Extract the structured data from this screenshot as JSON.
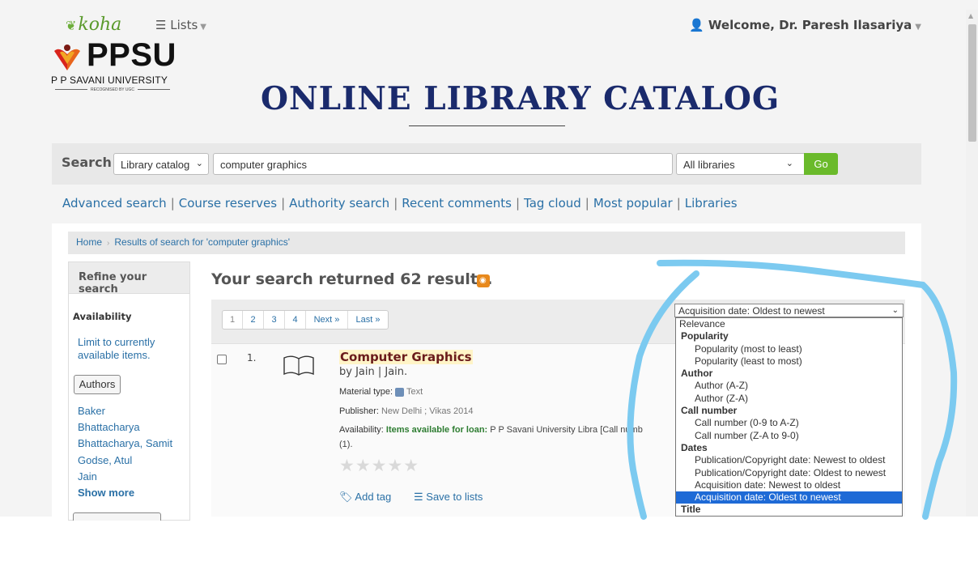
{
  "topbar": {
    "koha_label": "koha",
    "lists_label": "Lists",
    "welcome_text": "Welcome, Dr. Paresh Ilasariya"
  },
  "branding": {
    "logo_text": "PPSU",
    "university_name": "P P SAVANI UNIVERSITY",
    "recognition": "RECOGNISED BY UGC",
    "catalog_title": "ONLINE LIBRARY CATALOG"
  },
  "search": {
    "label": "Search",
    "scope_value": "Library catalog",
    "query_value": "computer graphics",
    "branch_value": "All libraries",
    "go_label": "Go"
  },
  "links": [
    "Advanced search",
    "Course reserves",
    "Authority search",
    "Recent comments",
    "Tag cloud",
    "Most popular",
    "Libraries"
  ],
  "breadcrumb": {
    "home": "Home",
    "current": "Results of search for 'computer graphics'"
  },
  "refine": {
    "heading": "Refine your search",
    "availability_title": "Availability",
    "limit_link": "Limit to currently available items.",
    "authors_button": "Authors",
    "authors": [
      "Baker",
      "Bhattacharya",
      "Bhattacharya, Samit",
      "Godse, Atul",
      "Jain"
    ],
    "show_more": "Show more"
  },
  "results": {
    "summary": "Your search returned 62 results.",
    "pager": [
      "1",
      "2",
      "3",
      "4",
      "Next »",
      "Last »"
    ],
    "sort_selected": "Acquisition date: Oldest to newest",
    "sort_options": [
      {
        "label": "Relevance",
        "kind": "plain"
      },
      {
        "label": "Popularity",
        "kind": "group"
      },
      {
        "label": "Popularity (most to least)",
        "kind": "option"
      },
      {
        "label": "Popularity (least to most)",
        "kind": "option"
      },
      {
        "label": "Author",
        "kind": "group"
      },
      {
        "label": "Author (A-Z)",
        "kind": "option"
      },
      {
        "label": "Author (Z-A)",
        "kind": "option"
      },
      {
        "label": "Call number",
        "kind": "group"
      },
      {
        "label": "Call number (0-9 to A-Z)",
        "kind": "option"
      },
      {
        "label": "Call number (Z-A to 9-0)",
        "kind": "option"
      },
      {
        "label": "Dates",
        "kind": "group"
      },
      {
        "label": "Publication/Copyright date: Newest to oldest",
        "kind": "option"
      },
      {
        "label": "Publication/Copyright date: Oldest to newest",
        "kind": "option"
      },
      {
        "label": "Acquisition date: Newest to oldest",
        "kind": "option"
      },
      {
        "label": "Acquisition date: Oldest to newest",
        "kind": "option",
        "selected": true
      },
      {
        "label": "Title",
        "kind": "group"
      }
    ],
    "items": [
      {
        "number": "1.",
        "title": "Computer Graphics",
        "author": "by Jain | Jain.",
        "material_label": "Material type:",
        "material_value": "Text",
        "publisher_label": "Publisher:",
        "publisher_value": "New Delhi ; Vikas 2014",
        "availability_label": "Availability:",
        "availability_status": "Items available for loan:",
        "availability_detail": "P P Savani University Libra",
        "availability_callnum": "[Call numb",
        "availability_count": "(1).",
        "add_tag": "Add tag",
        "save_to_lists": "Save to lists"
      }
    ]
  },
  "colors": {
    "link": "#2a70a6",
    "go_button": "#6aba2b",
    "catalog_title": "#1a2a6c",
    "annotation_stroke": "#7ccaf0",
    "dropdown_highlight": "#1e6ad6"
  }
}
